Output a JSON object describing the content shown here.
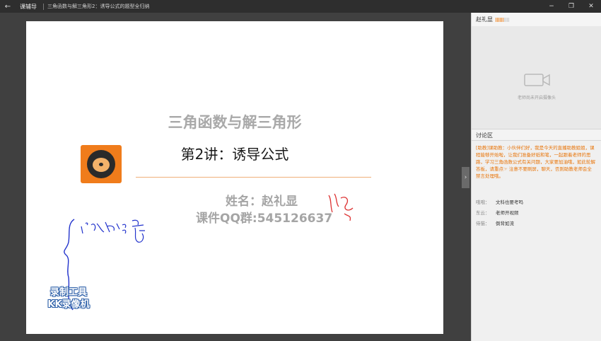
{
  "titlebar": {
    "app_name": "课辅导",
    "lesson_title": "三角函数与解三角形2：诱导公式的题型全归纳",
    "back_symbol": "←",
    "min_symbol": "−",
    "restore_symbol": "❐",
    "close_symbol": "✕"
  },
  "slide": {
    "title": "三角函数与解三角形",
    "subtitle": "第2讲：诱导公式",
    "name": "姓名：赵礼显",
    "qq": "课件QQ群:545126637",
    "watermark_line1": "录制工具",
    "watermark_line2": "KK录像机"
  },
  "panel": {
    "teacher_name": "赵礼显",
    "volume_level": 0.6,
    "camera_status": "老师尚未开启摄像头",
    "discussion_title": "讨论区",
    "announcement": "[助教]课助教：小伙伴们好，我是今天的直播助教姐姐，课程能够开始啦，让我们准备好纸和笔，一起跟着老师的思路，学习三角函数公式有关问题，大家要加油哦，如此轮解答板，请重点☞ 注意不要刷屏，聊天，否则助教老师会全禁言处理哦。",
    "messages": [
      {
        "user": "哦哦：",
        "text": "文科也要考吗"
      },
      {
        "user": "东云：",
        "text": "老师开视频"
      },
      {
        "user": "侍猫：",
        "text": "倒背如流"
      }
    ],
    "collapse_symbol": "›",
    "accent_color": "#f07c1b"
  }
}
